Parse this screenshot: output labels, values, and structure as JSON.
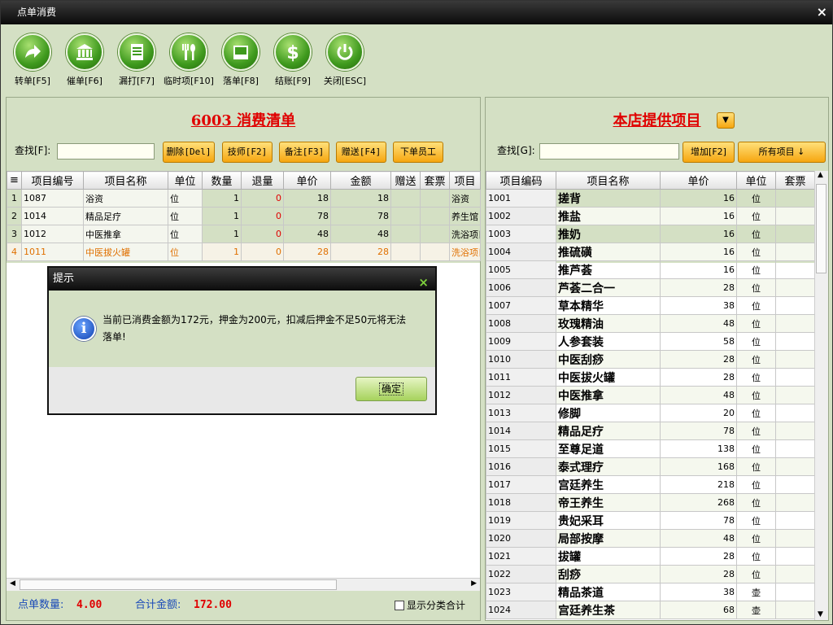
{
  "window": {
    "title": "点单消费",
    "close": "×"
  },
  "toolbar": [
    {
      "label": "转单[F5]",
      "icon": "forward-icon"
    },
    {
      "label": "催单[F6]",
      "icon": "bank-icon"
    },
    {
      "label": "漏打[F7]",
      "icon": "document-icon"
    },
    {
      "label": "临时项[F10]",
      "icon": "cutlery-icon"
    },
    {
      "label": "落单[F8]",
      "icon": "tray-icon"
    },
    {
      "label": "结账[F9]",
      "icon": "dollar-icon"
    },
    {
      "label": "关闭[ESC]",
      "icon": "power-icon"
    }
  ],
  "left": {
    "title": "6003 消费清单",
    "find_label": "查找[F]:",
    "find_value": "",
    "buttons": [
      "删除[Del]",
      "技师[F2]",
      "备注[F3]",
      "赠送[F4]",
      "下单员工"
    ],
    "columns": [
      "≡",
      "项目编号",
      "项目名称",
      "单位",
      "数量",
      "退量",
      "单价",
      "金额",
      "赠送",
      "套票",
      "项目"
    ],
    "rows": [
      [
        "1",
        "1087",
        "浴资",
        "位",
        "1",
        "0",
        "18",
        "18",
        "",
        "",
        "浴资"
      ],
      [
        "2",
        "1014",
        "精品足疗",
        "位",
        "1",
        "0",
        "78",
        "78",
        "",
        "",
        "养生馆"
      ],
      [
        "3",
        "1012",
        "中医推拿",
        "位",
        "1",
        "0",
        "48",
        "48",
        "",
        "",
        "洗浴项目"
      ],
      [
        "4",
        "1011",
        "中医拔火罐",
        "位",
        "1",
        "0",
        "28",
        "28",
        "",
        "",
        "洗浴项目"
      ]
    ],
    "footer": {
      "count_label": "点单数量:",
      "count_value": "4.00",
      "total_label": "合计金额:",
      "total_value": "172.00",
      "checkbox_label": "显示分类合计",
      "checkbox_checked": false
    }
  },
  "right": {
    "title": "本店提供项目",
    "find_label": "查找[G]:",
    "find_value": "",
    "add_button": "增加[F2]",
    "filter_button": "所有项目 ↓",
    "columns": [
      "项目编码",
      "项目名称",
      "单价",
      "单位",
      "套票"
    ],
    "rows": [
      [
        "1001",
        "搓背",
        "16",
        "位",
        ""
      ],
      [
        "1002",
        "推盐",
        "16",
        "位",
        ""
      ],
      [
        "1003",
        "推奶",
        "16",
        "位",
        ""
      ],
      [
        "1004",
        "推硫磺",
        "16",
        "位",
        ""
      ],
      [
        "1005",
        "推芦荟",
        "16",
        "位",
        ""
      ],
      [
        "1006",
        "芦荟二合一",
        "28",
        "位",
        ""
      ],
      [
        "1007",
        "草本精华",
        "38",
        "位",
        ""
      ],
      [
        "1008",
        "玫瑰精油",
        "48",
        "位",
        ""
      ],
      [
        "1009",
        "人参套装",
        "58",
        "位",
        ""
      ],
      [
        "1010",
        "中医刮痧",
        "28",
        "位",
        ""
      ],
      [
        "1011",
        "中医拔火罐",
        "28",
        "位",
        ""
      ],
      [
        "1012",
        "中医推拿",
        "48",
        "位",
        ""
      ],
      [
        "1013",
        "修脚",
        "20",
        "位",
        ""
      ],
      [
        "1014",
        "精品足疗",
        "78",
        "位",
        ""
      ],
      [
        "1015",
        "至尊足道",
        "138",
        "位",
        ""
      ],
      [
        "1016",
        "泰式理疗",
        "168",
        "位",
        ""
      ],
      [
        "1017",
        "宫廷养生",
        "218",
        "位",
        ""
      ],
      [
        "1018",
        "帝王养生",
        "268",
        "位",
        ""
      ],
      [
        "1019",
        "贵妃采耳",
        "78",
        "位",
        ""
      ],
      [
        "1020",
        "局部按摩",
        "48",
        "位",
        ""
      ],
      [
        "1021",
        "拔罐",
        "28",
        "位",
        ""
      ],
      [
        "1022",
        "刮痧",
        "28",
        "位",
        ""
      ],
      [
        "1023",
        "精品茶道",
        "38",
        "壶",
        ""
      ],
      [
        "1024",
        "宫廷养生茶",
        "68",
        "壶",
        ""
      ]
    ]
  },
  "dialog": {
    "title": "提示",
    "close": "×",
    "message": "当前已消费金额为172元，押金为200元，扣减后押金不足50元将无法落单!",
    "ok_label": "确定"
  },
  "colors": {
    "accent_red": "#e00000",
    "button_orange": "#f6a610",
    "panel_green": "#d4e0c4",
    "selected_row": "#e07000"
  }
}
